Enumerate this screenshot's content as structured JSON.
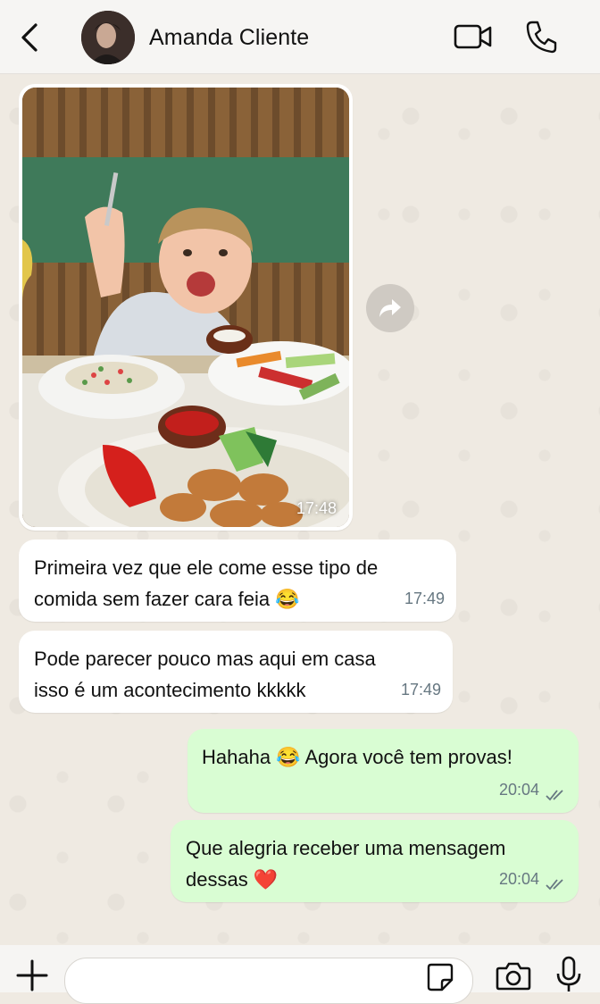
{
  "header": {
    "contact_name": "Amanda Cliente",
    "back_icon": "chevron-left-icon",
    "video_icon": "video-call-icon",
    "call_icon": "phone-icon"
  },
  "messages": [
    {
      "type": "image",
      "direction": "incoming",
      "time": "17:48",
      "image_desc": "child eating at restaurant"
    },
    {
      "type": "text",
      "direction": "incoming",
      "text": "Primeira vez que ele come esse tipo de\ncomida sem fazer cara feia 😂",
      "time": "17:49"
    },
    {
      "type": "text",
      "direction": "incoming",
      "text": "Pode parecer pouco mas aqui em casa\nisso é um acontecimento kkkkk",
      "time": "17:49"
    },
    {
      "type": "text",
      "direction": "outgoing",
      "text": "Hahaha 😂  Agora você tem provas!",
      "time": "20:04",
      "status": "read"
    },
    {
      "type": "text",
      "direction": "outgoing",
      "text": "Que alegria receber uma mensagem\ndessas ❤️",
      "time": "20:04",
      "status": "read"
    }
  ],
  "composer": {
    "value": "",
    "placeholder": ""
  },
  "colors": {
    "incoming_bubble": "#ffffff",
    "outgoing_bubble": "#d9fdd3",
    "chat_background": "#efeae2",
    "meta_text": "#667781",
    "read_ticks": "#667781"
  }
}
